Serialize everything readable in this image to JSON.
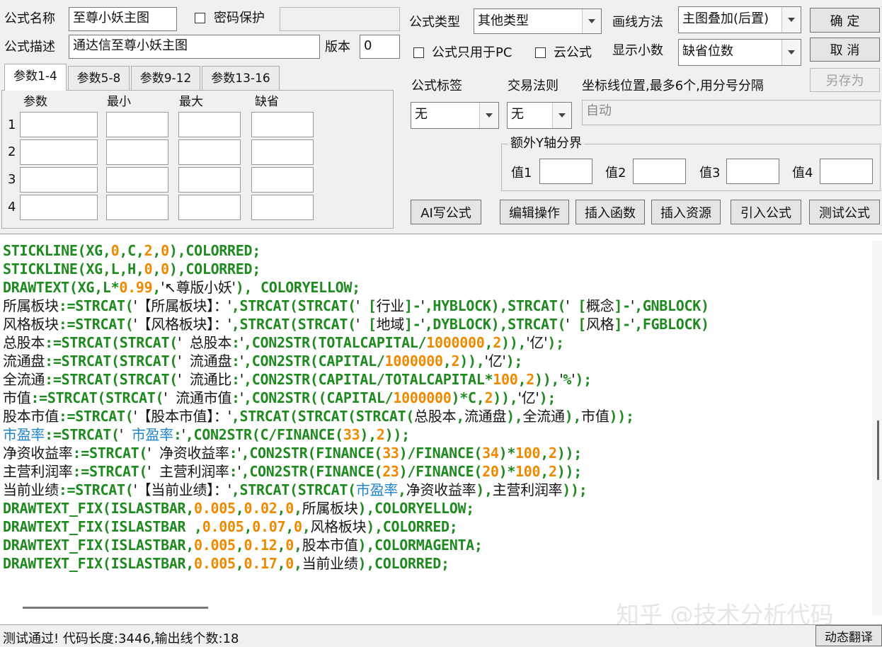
{
  "form": {
    "name_label": "公式名称",
    "name_value": "至尊小妖主图",
    "password_label": "密码保护",
    "desc_label": "公式描述",
    "desc_value": "通达信至尊小妖主图",
    "version_label": "版本",
    "version_value": "0"
  },
  "tabs": [
    "参数1-4",
    "参数5-8",
    "参数9-12",
    "参数13-16"
  ],
  "params": {
    "headers": [
      "参数",
      "最小",
      "最大",
      "缺省"
    ],
    "rows": [
      "1",
      "2",
      "3",
      "4"
    ]
  },
  "right": {
    "type_label": "公式类型",
    "type_value": "其他类型",
    "draw_label": "画线方法",
    "draw_value": "主图叠加(后置)",
    "pc_only_label": "公式只用于PC",
    "cloud_label": "云公式",
    "decimals_label": "显示小数",
    "decimals_value": "缺省位数",
    "tag_label": "公式标签",
    "tag_value": "无",
    "rule_label": "交易法则",
    "rule_value": "无",
    "coord_label": "坐标线位置,最多6个,用分号分隔",
    "coord_value": "自动",
    "yaxis_group": "额外Y轴分界",
    "val_labels": [
      "值1",
      "值2",
      "值3",
      "值4"
    ]
  },
  "buttons": {
    "ok": "确  定",
    "cancel": "取  消",
    "save_as": "另存为",
    "ai_write": "AI写公式",
    "edit_ops": "编辑操作",
    "insert_func": "插入函数",
    "insert_res": "插入资源",
    "import_formula": "引入公式",
    "test_formula": "测试公式",
    "dynamic_translate": "动态翻译"
  },
  "code_lines": [
    "STICKLINE(XG,0,C,2,0),COLORRED;",
    "STICKLINE(XG,L,H,0,0),COLORRED;",
    "DRAWTEXT(XG,L*0.99,'↖尊版小妖'), COLORYELLOW;",
    "所属板块:=STRCAT('【所属板块】：',STRCAT(STRCAT(' [行业]-',HYBLOCK),STRCAT(' [概念]-',GNBLOCK)",
    "风格板块:=STRCAT('【风格板块】：',STRCAT(STRCAT(' [地域]-',DYBLOCK),STRCAT(' [风格]-',FGBLOCK)",
    "总股本:=STRCAT(STRCAT(' 总股本:',CON2STR(TOTALCAPITAL/1000000,2)),'亿');",
    "流通盘:=STRCAT(STRCAT(' 流通盘:',CON2STR(CAPITAL/1000000,2)),'亿');",
    "全流通:=STRCAT(STRCAT(' 流通比:',CON2STR(CAPITAL/TOTALCAPITAL*100,2)),'%');",
    "市值:=STRCAT(STRCAT(' 流通市值:',CON2STR((CAPITAL/1000000)*C,2)),'亿');",
    "股本市值:=STRCAT('【股本市值】：',STRCAT(STRCAT(STRCAT(总股本,流通盘),全流通),市值));",
    "市盈率:=STRCAT(' 市盈率:',CON2STR(C/FINANCE(33),2));",
    "净资收益率:=STRCAT(' 净资收益率:',CON2STR(FINANCE(33)/FINANCE(34)*100,2));",
    "主营利润率:=STRCAT(' 主营利润率:',CON2STR(FINANCE(23)/FINANCE(20)*100,2));",
    "当前业绩:=STRCAT('【当前业绩】：',STRCAT(STRCAT(市盈率,净资收益率),主营利润率));",
    "DRAWTEXT_FIX(ISLASTBAR,0.005,0.02,0,所属板块),COLORYELLOW;",
    "DRAWTEXT_FIX(ISLASTBAR ,0.005,0.07,0,风格板块),COLORRED;",
    "DRAWTEXT_FIX(ISLASTBAR,0.005,0.12,0,股本市值),COLORMAGENTA;",
    "DRAWTEXT_FIX(ISLASTBAR,0.005,0.17,0,当前业绩),COLORRED;"
  ],
  "status": "测试通过! 代码长度:3446,输出线个数:18",
  "watermark": "知乎 @技术分析代码",
  "colors": {
    "keyword": "#1f8a1f",
    "number": "#ee8a00",
    "highlight": "#1f84c8",
    "text": "#151515"
  }
}
